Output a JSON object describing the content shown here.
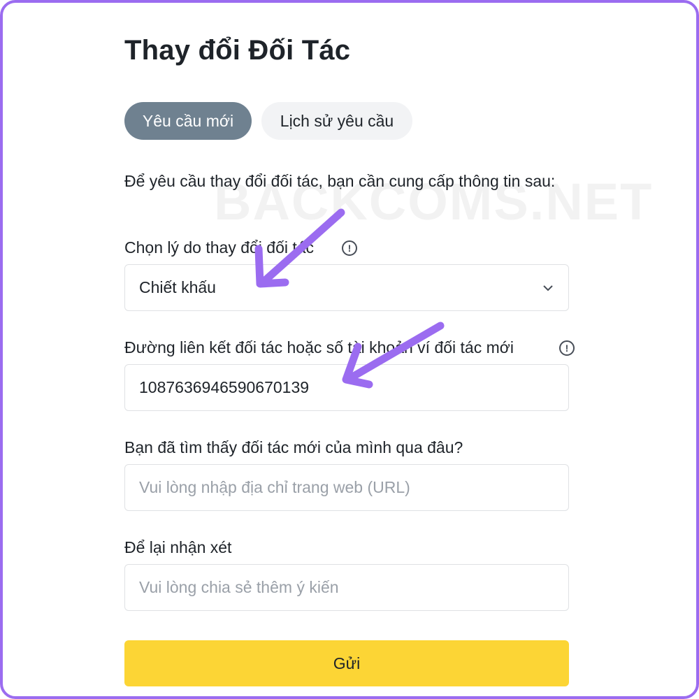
{
  "page": {
    "title": "Thay đổi Đối Tác"
  },
  "tabs": [
    {
      "label": "Yêu cầu mới",
      "active": true
    },
    {
      "label": "Lịch sử yêu cầu",
      "active": false
    }
  ],
  "intro": "Để yêu cầu thay đổi đối tác, bạn cần cung cấp thông tin sau:",
  "form": {
    "reason": {
      "label": "Chọn lý do thay đổi đối tác",
      "value": "Chiết khấu",
      "info_icon": "info-icon"
    },
    "partner_link": {
      "label": "Đường liên kết đối tác hoặc số tài khoản ví đối tác mới",
      "value": "1087636946590670139",
      "info_icon": "info-icon"
    },
    "source": {
      "label": "Bạn đã tìm thấy đối tác mới của mình qua đâu?",
      "placeholder": "Vui lòng nhập địa chỉ trang web (URL)"
    },
    "comment": {
      "label": "Để lại nhận xét",
      "placeholder": "Vui lòng chia sẻ thêm ý kiến"
    }
  },
  "submit_label": "Gửi",
  "watermark": "BACKCOMS.NET",
  "colors": {
    "frame_border": "#9b6cf0",
    "tab_active": "#6f8190",
    "tab_inactive": "#f2f3f5",
    "submit": "#fcd535",
    "annotation_arrow": "#9b6cf0"
  }
}
